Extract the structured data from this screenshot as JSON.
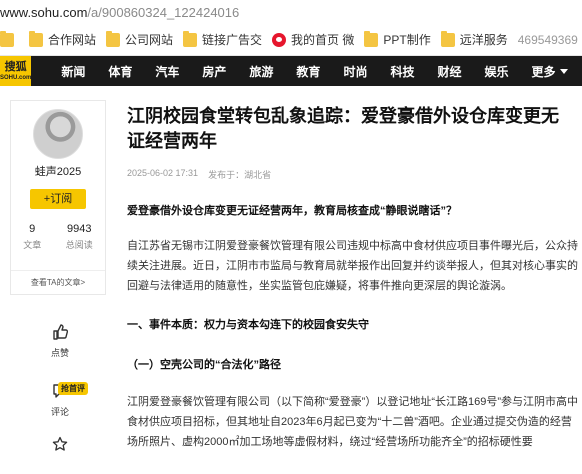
{
  "address": {
    "host": "www.sohu.com",
    "path": "/a/900860324_122424016"
  },
  "bookmarks": {
    "items": [
      {
        "label": "",
        "icon": "folder-icon"
      },
      {
        "label": "合作网站",
        "icon": "folder-icon"
      },
      {
        "label": "公司网站",
        "icon": "folder-icon"
      },
      {
        "label": "链接广告交",
        "icon": "folder-icon"
      },
      {
        "label": "我的首页 微",
        "icon": "weibo-icon"
      },
      {
        "label": "PPT制作",
        "icon": "folder-icon"
      },
      {
        "label": "远洋服务",
        "icon": "folder-icon"
      }
    ],
    "right_text": "469549369"
  },
  "nav": {
    "logo_top": "搜狐",
    "logo_bottom": "SOHU.com",
    "items": [
      "新闻",
      "体育",
      "汽车",
      "房产",
      "旅游",
      "教育",
      "时尚",
      "科技",
      "财经",
      "娱乐"
    ],
    "more": "更多"
  },
  "author": {
    "name": "蛙声2025",
    "follow": "+订阅",
    "articles_count": "9",
    "articles_label": "文章",
    "views_count": "9943",
    "views_label": "总阅读",
    "all_link": "查看TA的文章>"
  },
  "actions": {
    "like_label": "点赞",
    "comment_label": "评论",
    "hot_badge": "抢首评"
  },
  "article": {
    "title": "江阴校园食堂转包乱象追踪：爱登豪借外设仓库变更无证经营两年",
    "date": "2025-06-02 17:31",
    "source": "发布于：湖北省",
    "lead": "爱登豪借外设仓库变更无证经营两年，教育局核查成“静眼说瞎话”？",
    "p1": "自江苏省无锡市江阴爱登豪餐饮管理有限公司违规中标高中食材供应项目事件曝光后，公众持续关注进展。近日，江阴市市监局与教育局就举报作出回复并约谈举报人，但其对核心事实的回避与法律适用的随意性，坐实监管包庇嫌疑，将事件推向更深层的舆论漩涡。",
    "h2": "一、事件本质：权力与资本勾连下的校园食安失守",
    "h3": "（一）空壳公司的“合法化”路径",
    "p2": "江阴爱登豪餐饮管理有限公司（以下简称“爱登豪”）以登记地址“长江路169号”参与江阴市高中食材供应项目招标，但其地址自2023年6月起已变为“十二兽”酒吧。企业通过提交伪造的经营场所照片、虚构2000㎡加工场地等虚假材料，绕过“经营场所功能齐全”的招标硬性要"
  }
}
